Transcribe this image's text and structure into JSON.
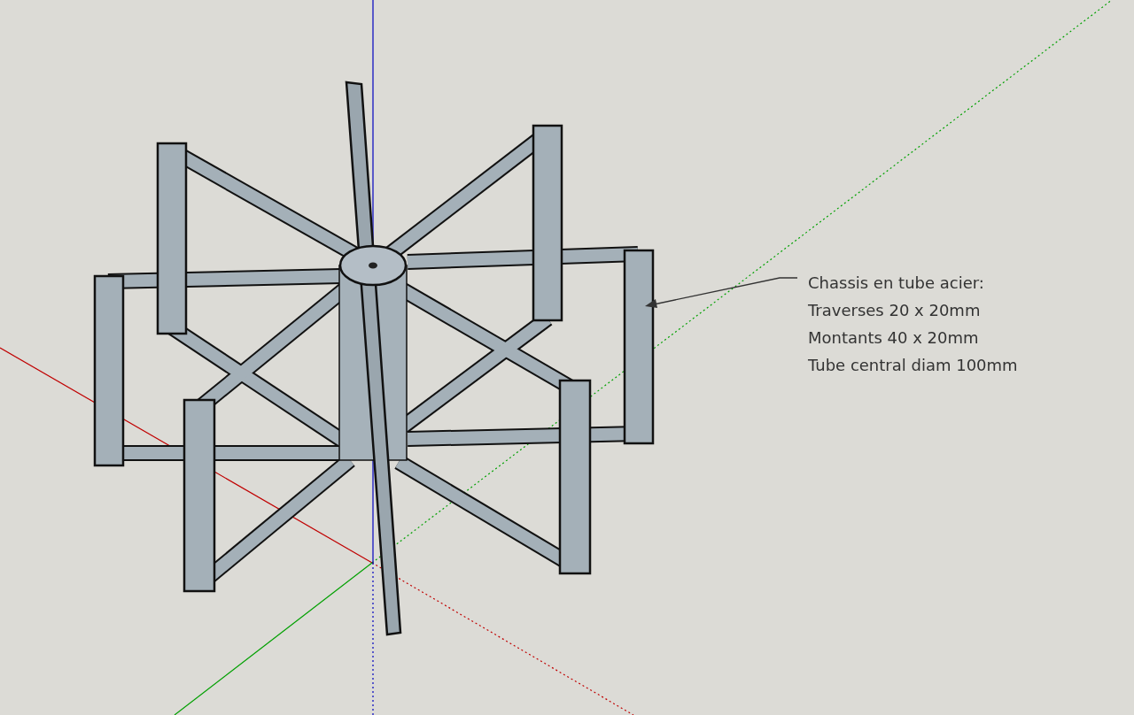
{
  "annotation": {
    "lines": [
      "Chassis en tube acier:",
      "Traverses 20 x 20mm",
      "Montants 40 x 20mm",
      "Tube central diam 100mm"
    ]
  }
}
